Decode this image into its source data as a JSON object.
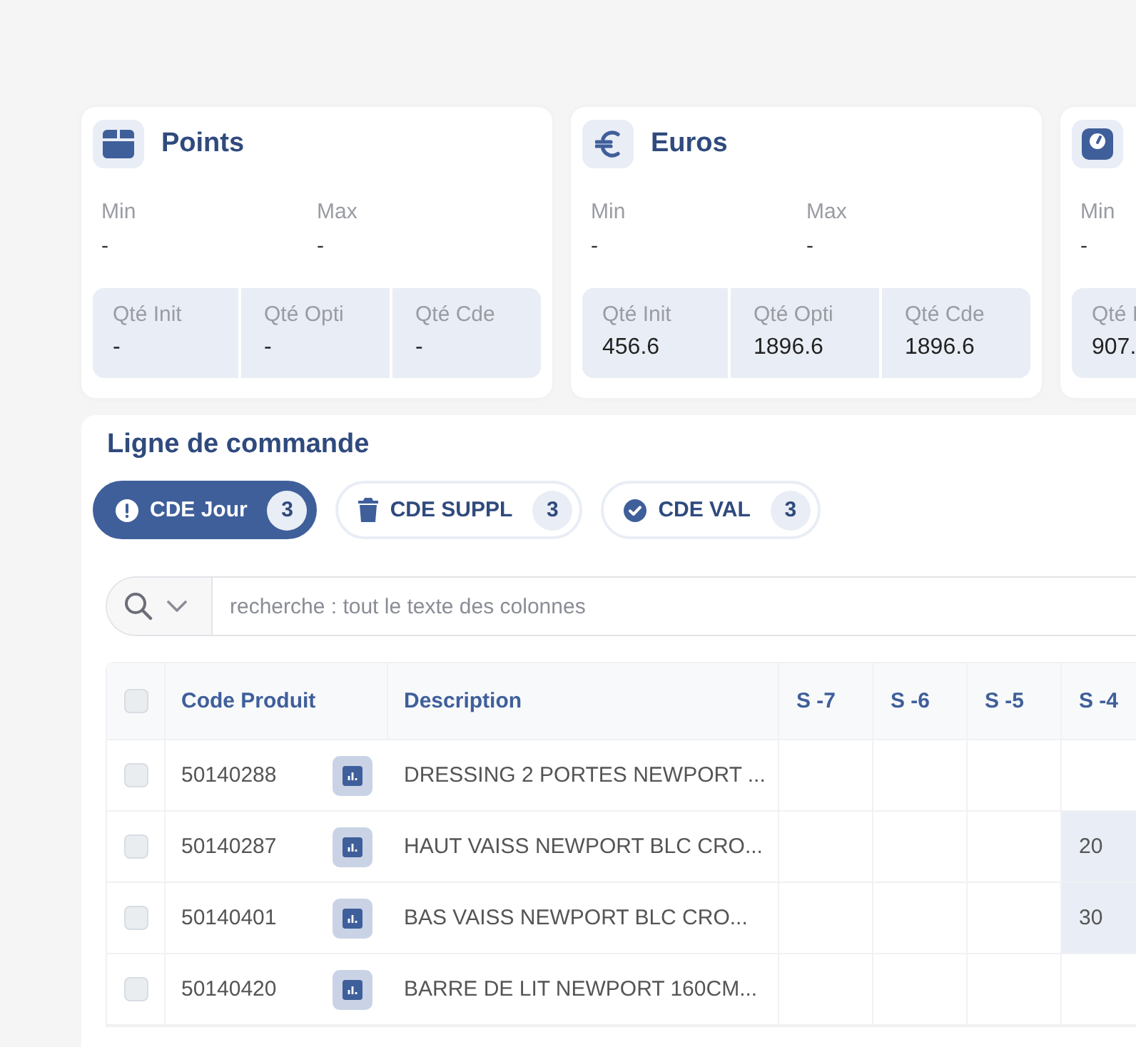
{
  "stat_cards": [
    {
      "kind": "box",
      "title": "Points",
      "min_label": "Min",
      "min_value": "-",
      "max_label": "Max",
      "max_value": "-",
      "quantities": [
        {
          "label": "Qté Init",
          "value": "-"
        },
        {
          "label": "Qté Opti",
          "value": "-"
        },
        {
          "label": "Qté Cde",
          "value": "-"
        }
      ]
    },
    {
      "kind": "euro",
      "title": "Euros",
      "min_label": "Min",
      "min_value": "-",
      "max_label": "Max",
      "max_value": "-",
      "quantities": [
        {
          "label": "Qté Init",
          "value": "456.6"
        },
        {
          "label": "Qté Opti",
          "value": "1896.6"
        },
        {
          "label": "Qté Cde",
          "value": "1896.6"
        }
      ]
    },
    {
      "kind": "scale",
      "min_label": "Min",
      "min_value": "-",
      "quantities": [
        {
          "label": "Qté I",
          "value": "907."
        }
      ]
    }
  ],
  "order_lines": {
    "title": "Ligne de commande",
    "chips": [
      {
        "kind": "alert",
        "label": "CDE Jour",
        "count": "3",
        "selected": true
      },
      {
        "kind": "trash",
        "label": "CDE SUPPL",
        "count": "3",
        "selected": false
      },
      {
        "kind": "check",
        "label": "CDE VAL",
        "count": "3",
        "selected": false
      }
    ],
    "search": {
      "placeholder": "recherche : tout le texte des colonnes"
    },
    "table": {
      "select_all_checked": false,
      "columns": [
        "Code Produit",
        "Description",
        "S -7",
        "S -6",
        "S -5",
        "S -4"
      ],
      "rows": [
        {
          "checked": false,
          "code": "50140288",
          "description": "DRESSING 2 PORTES NEWPORT ...",
          "weeks": [
            {
              "highlighted": false
            },
            {
              "highlighted": false
            },
            {
              "highlighted": false
            },
            {
              "highlighted": false
            }
          ]
        },
        {
          "checked": false,
          "code": "50140287",
          "description": "HAUT VAISS NEWPORT BLC CRO...",
          "weeks": [
            {
              "highlighted": false
            },
            {
              "highlighted": false
            },
            {
              "highlighted": false
            },
            {
              "value": "20",
              "highlighted": true
            }
          ]
        },
        {
          "checked": false,
          "code": "50140401",
          "description": "BAS VAISS NEWPORT BLC CRO...",
          "weeks": [
            {
              "highlighted": false
            },
            {
              "highlighted": false
            },
            {
              "highlighted": false
            },
            {
              "value": "30",
              "highlighted": true
            }
          ]
        },
        {
          "checked": false,
          "code": "50140420",
          "description": "BARRE DE LIT NEWPORT 160CM...",
          "weeks": [
            {
              "highlighted": false
            },
            {
              "highlighted": false
            },
            {
              "highlighted": false
            },
            {
              "highlighted": false
            }
          ]
        }
      ]
    }
  }
}
